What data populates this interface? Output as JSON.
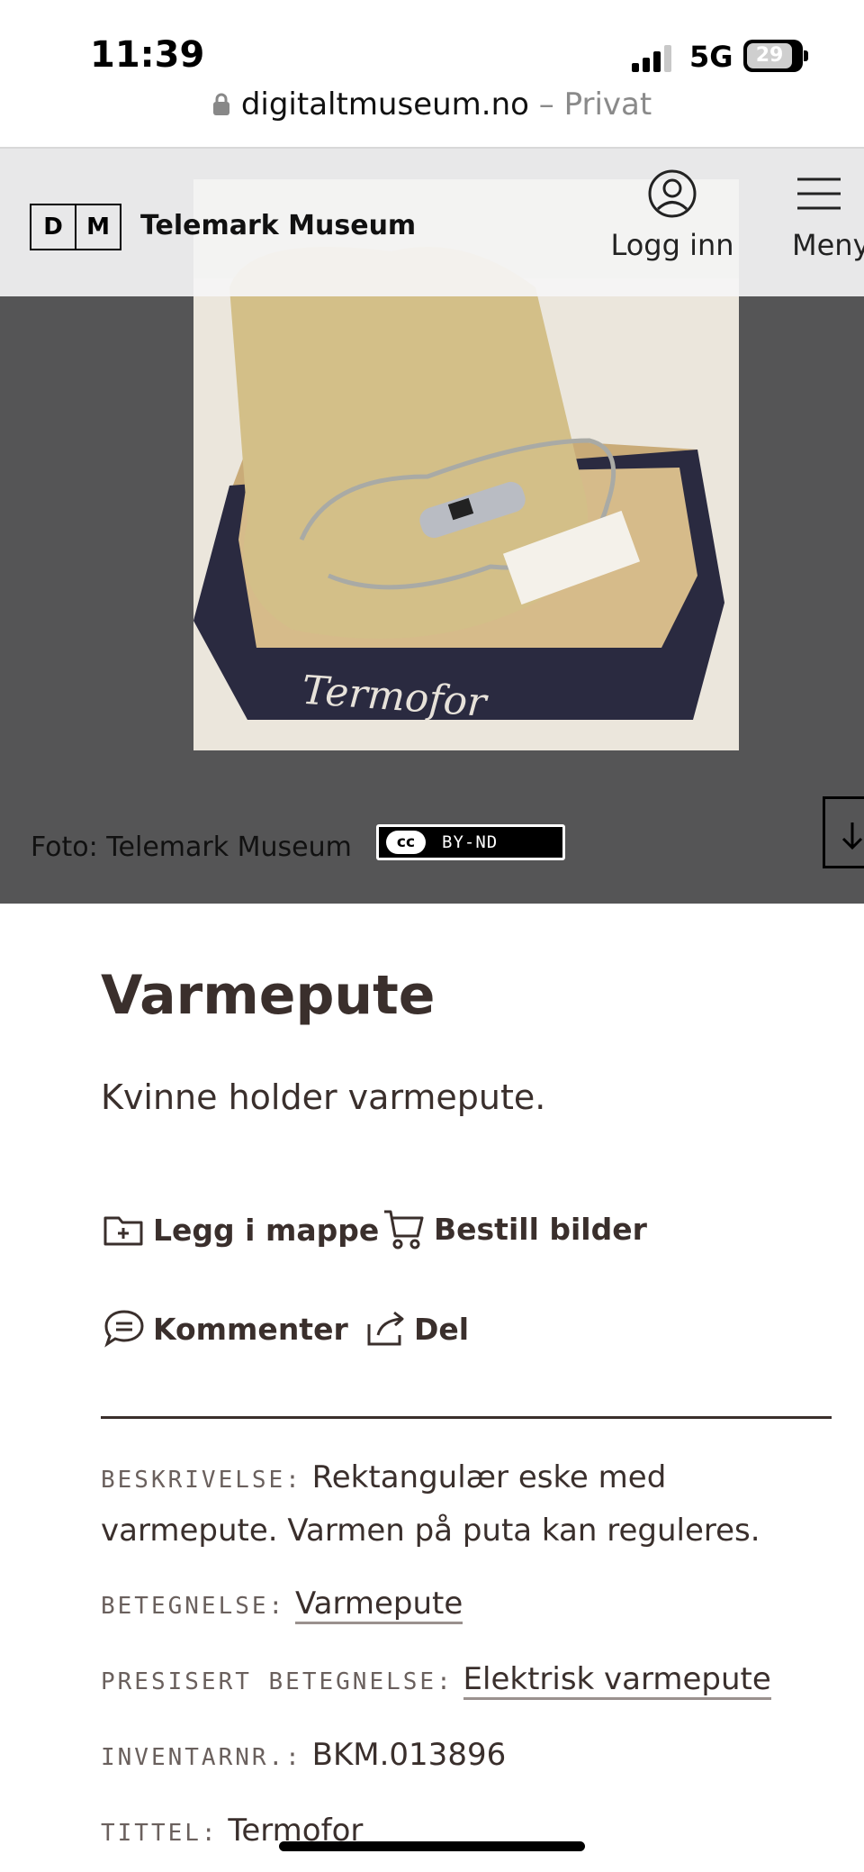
{
  "status_bar": {
    "time": "11:39",
    "network": "5G",
    "battery": "29"
  },
  "browser": {
    "domain": "digitaltmuseum.no",
    "mode": " – Privat"
  },
  "header": {
    "logo_left": "D",
    "logo_right": "M",
    "museum": "Telemark Museum",
    "login_label": "Logg inn",
    "menu_label": "Meny"
  },
  "media": {
    "credit": "Foto: Telemark Museum",
    "license_cc": "cc",
    "license_label": "BY-ND",
    "photo_brand": "Termofor"
  },
  "item": {
    "title": "Varmepute",
    "caption": "Kvinne holder varmepute."
  },
  "actions": {
    "add_to_folder": "Legg i mappe",
    "order_images": "Bestill bilder",
    "comment": "Kommenter",
    "share": "Del"
  },
  "details": [
    {
      "key": "BESKRIVELSE:",
      "value": "Rektangulær eske med varmepute. Varmen på puta kan reguleres."
    },
    {
      "key": "BETEGNELSE:",
      "value": "Varmepute"
    },
    {
      "key": "PRESISERT BETEGNELSE:",
      "value": "Elektrisk varmepute"
    },
    {
      "key": "INVENTARNR.:",
      "value": "BKM.013896"
    },
    {
      "key": "TITTEL:",
      "value": "Termofor"
    }
  ],
  "colors": {
    "text": "#3a2f2c",
    "hero_bg": "#555556",
    "header_bg": "#f5f5f5"
  }
}
